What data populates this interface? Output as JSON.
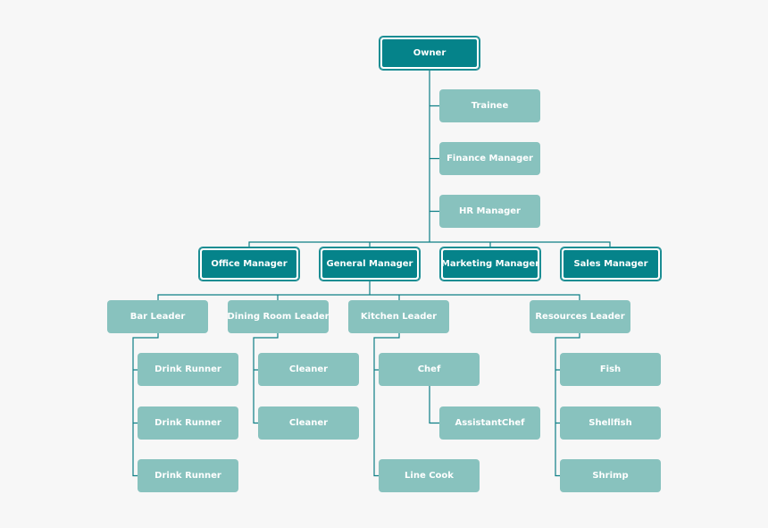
{
  "colors": {
    "primary": "#05838a",
    "secondary": "#88c2be",
    "connector": "#0e7f86",
    "background": "#f7f7f7"
  },
  "chart": {
    "owner": "Owner",
    "staff": [
      "Trainee",
      "Finance Manager",
      "HR Manager"
    ],
    "managers": [
      "Office Manager",
      "General Manager",
      "Marketing Manager",
      "Sales Manager"
    ],
    "leaders": [
      "Bar Leader",
      "Dining Room Leader",
      "Kitchen Leader",
      "Resources Leader"
    ],
    "bar": [
      "Drink Runner",
      "Drink Runner",
      "Drink Runner"
    ],
    "dining": [
      "Cleaner",
      "Cleaner"
    ],
    "kitchen": [
      "Chef",
      "AssistantChef",
      "Line Cook"
    ],
    "resources": [
      "Fish",
      "Shellfish",
      "Shrimp"
    ]
  }
}
